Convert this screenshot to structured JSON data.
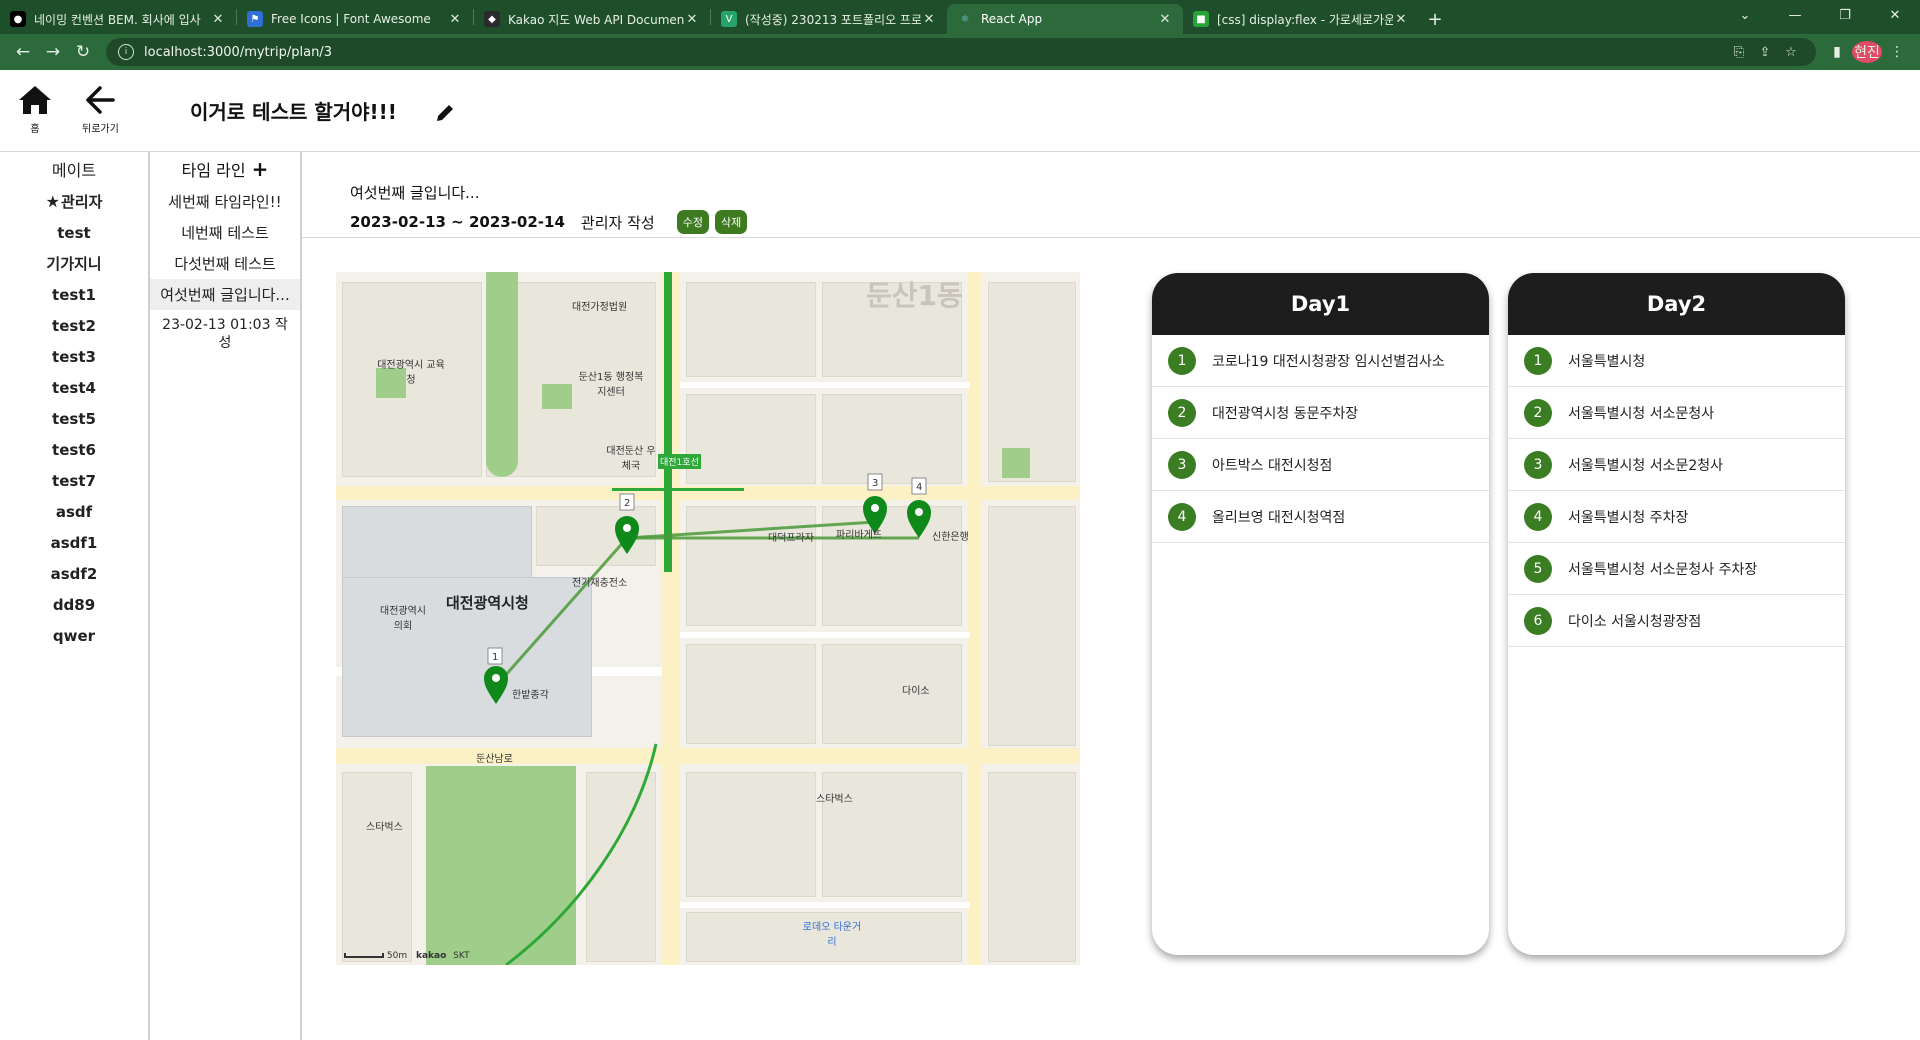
{
  "browser": {
    "tabs": [
      {
        "title": "네이밍 컨벤션 BEM. 회사에 입사",
        "active": false
      },
      {
        "title": "Free Icons | Font Awesome",
        "active": false
      },
      {
        "title": "Kakao 지도 Web API Document",
        "active": false
      },
      {
        "title": "(작성중) 230213 포트폴리오 프로",
        "active": false
      },
      {
        "title": "React App",
        "active": true
      },
      {
        "title": "[css] display:flex - 가로세로가운",
        "active": false
      }
    ],
    "url": "localhost:3000/mytrip/plan/3",
    "avatar_text": "현진"
  },
  "header": {
    "home_label": "홈",
    "back_label": "뒤로가기",
    "plan_title": "이거로 테스트 할거야!!!"
  },
  "mates": {
    "header": "메이트",
    "admin_label": "관리자",
    "items": [
      "test",
      "기가지니",
      "test1",
      "test2",
      "test3",
      "test4",
      "test5",
      "test6",
      "test7",
      "asdf",
      "asdf1",
      "asdf2",
      "dd89",
      "qwer"
    ]
  },
  "timeline": {
    "header": "타임 라인",
    "items": [
      "세번째 타임라인!!",
      "네번째 테스트",
      "다섯번째 테스트",
      "여섯번째 글입니다..."
    ],
    "active_index": 3,
    "active_date": "23-02-13 01:03 작성"
  },
  "post": {
    "title": "여섯번째 글입니다...",
    "date_range": "2023-02-13 ~ 2023-02-14",
    "author": "관리자 작성",
    "edit_label": "수정",
    "delete_label": "삭제"
  },
  "map": {
    "labels": {
      "city_hall": "대전광역시청",
      "edu_office": "대전광역시 교육청",
      "court": "대전가정법원",
      "welfare": "둔산1동 행정복지센터",
      "post_office": "대전둔산 우체국",
      "council": "대전광역시 의회",
      "hanbat": "한밭종각",
      "tax": "전기재충전소",
      "road": "둔산남로",
      "plaza": "대덕프라자",
      "paris": "파리바게뜨",
      "shinhan": "신한은행",
      "daiso": "다이소",
      "starbucks1": "스타벅스",
      "starbucks2": "스타벅스",
      "lotte": "로데오 타운거리",
      "district": "둔산1동",
      "metro": "대전1호선",
      "scale": "50m",
      "kakao": "kakao",
      "skt": "SKT"
    }
  },
  "days": [
    {
      "title": "Day1",
      "places": [
        "코로나19 대전시청광장 임시선별검사소",
        "대전광역시청 동문주차장",
        "아트박스 대전시청점",
        "올리브영 대전시청역점"
      ]
    },
    {
      "title": "Day2",
      "places": [
        "서울특별시청",
        "서울특별시청 서소문청사",
        "서울특별시청 서소문2청사",
        "서울특별시청 주차장",
        "서울특별시청 서소문청사 주차장",
        "다이소 서울시청광장점"
      ]
    }
  ],
  "colors": {
    "accent_green": "#3b7d22",
    "marker_green": "#0f8a1a",
    "route_green": "#4a9a3a",
    "day_header": "#1d1d1d",
    "chrome_green": "#2d6a3b"
  }
}
